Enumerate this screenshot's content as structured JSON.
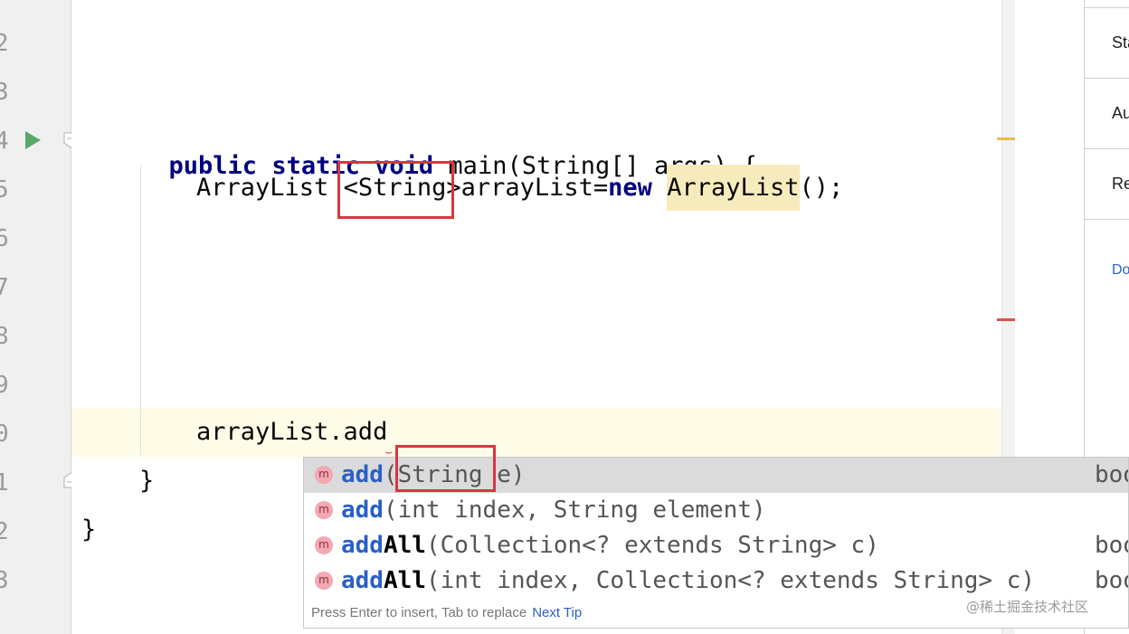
{
  "gutter": {
    "line_numbers": [
      "2",
      "3",
      "4",
      "5",
      "6",
      "7",
      "8",
      "9",
      "0",
      "1",
      "2",
      "3"
    ]
  },
  "code": {
    "line1": {
      "kw1": "public",
      "kw2": "static",
      "kw3": "void",
      "rest": " main(String[] args) {"
    },
    "line2": {
      "type": "ArrayList ",
      "generic": "<String>",
      "var": "arrayList=",
      "kw": "new",
      "space": " ",
      "ctor": "ArrayList",
      "end": "();"
    },
    "line3": {
      "text": "arrayList.add"
    },
    "line4": {
      "text": "}"
    },
    "line5": {
      "text": "}"
    }
  },
  "right_panel": {
    "items": [
      "Sta",
      "Au",
      "Re",
      "Do"
    ],
    "link_color": "#2a5fc7"
  },
  "completion": {
    "items": [
      {
        "name": "add",
        "name_rest": "",
        "params": "(String e)",
        "type": "boo",
        "selected": true
      },
      {
        "name": "add",
        "name_rest": "",
        "params": "(int index, String element)",
        "type": "",
        "selected": false
      },
      {
        "name": "add",
        "name_rest": "All",
        "params": "(Collection<? extends String> c)",
        "type": "boo",
        "selected": false
      },
      {
        "name": "add",
        "name_rest": "All",
        "params": "(int index, Collection<? extends String> c)",
        "type": "boo",
        "selected": false
      }
    ],
    "icon_letter": "m",
    "footer_text": "Press Enter to insert, Tab to replace",
    "footer_link": "Next Tip"
  },
  "watermark": "@稀土掘金技术社区",
  "colors": {
    "keyword": "#000080",
    "highlight_box": "#d9363e",
    "method_name": "#2a5fc7",
    "run_icon": "#59a869"
  }
}
